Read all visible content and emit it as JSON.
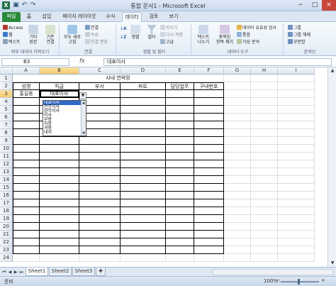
{
  "window": {
    "title": "통합 문서1 - Microsoft Excel",
    "app_icon_label": "X",
    "qat_icons": [
      "save-icon",
      "undo-icon",
      "redo-icon"
    ],
    "controls": [
      "−",
      "□",
      "×"
    ]
  },
  "ribbon_tabs": [
    {
      "label": "파일",
      "kind": "file"
    },
    {
      "label": "홈"
    },
    {
      "label": "삽입"
    },
    {
      "label": "페이지 레이아웃"
    },
    {
      "label": "수식"
    },
    {
      "label": "데이터",
      "active": true
    },
    {
      "label": "검토"
    },
    {
      "label": "보기"
    }
  ],
  "ribbon": {
    "groups": {
      "external": {
        "label": "외부 데이터 가져오기",
        "small": [
          "Access",
          "웹",
          "텍스트"
        ],
        "big": [
          [
            "기타",
            "원본"
          ],
          [
            "기존",
            "연결"
          ]
        ]
      },
      "connections": {
        "label": "연결",
        "big": [
          [
            "모두 새로",
            "고침"
          ]
        ],
        "small": [
          "연결",
          "속성",
          "연결 편집"
        ]
      },
      "sort": {
        "label": "정렬 및 필터",
        "big": [
          "정렬",
          "필터"
        ],
        "small": [
          "지우기",
          "다시 적용",
          "고급"
        ]
      },
      "tools": {
        "label": "데이터 도구",
        "big": [
          [
            "텍스트",
            "나누기"
          ],
          [
            "중복된",
            "항목 제거"
          ]
        ],
        "small": [
          "데이터 유효성 검사",
          "통합",
          "가상 분석"
        ]
      },
      "outline": {
        "label": "윤곽선",
        "small": [
          "그룹",
          "그룹 해제",
          "부분합"
        ]
      }
    }
  },
  "formula_bar": {
    "name_box": "B3",
    "fx": "fx",
    "value": "대표이사"
  },
  "columns": [
    "A",
    "B",
    "C",
    "D",
    "E",
    "F",
    "G",
    "H",
    "I"
  ],
  "rows": [
    "1",
    "2",
    "3",
    "4",
    "5",
    "6",
    "7",
    "8",
    "9",
    "10",
    "11",
    "12",
    "13",
    "14",
    "15",
    "16",
    "17",
    "18",
    "19",
    "20",
    "21",
    "22",
    "23",
    "24"
  ],
  "table": {
    "title": "사내 연락망",
    "headers": [
      "성명",
      "직급",
      "부서",
      "파트",
      "담당업무",
      "구내번호"
    ],
    "row3": [
      "홍길동",
      "대표이사",
      "",
      "",
      "",
      ""
    ]
  },
  "dropdown": {
    "arrow": "▼",
    "options": [
      "대표이사",
      "전무이사",
      "상무이사",
      "이사",
      "부장",
      "차장",
      "과장",
      "대리"
    ],
    "selected": 0
  },
  "sheets": [
    "Sheet1",
    "Sheet2",
    "Sheet3"
  ],
  "status": {
    "mode": "준비",
    "zoom": "100%"
  },
  "colors": {
    "file_tab": "#2a8a3b",
    "selection_header": "#f6c96b",
    "dropdown_selected": "#3169c6"
  }
}
